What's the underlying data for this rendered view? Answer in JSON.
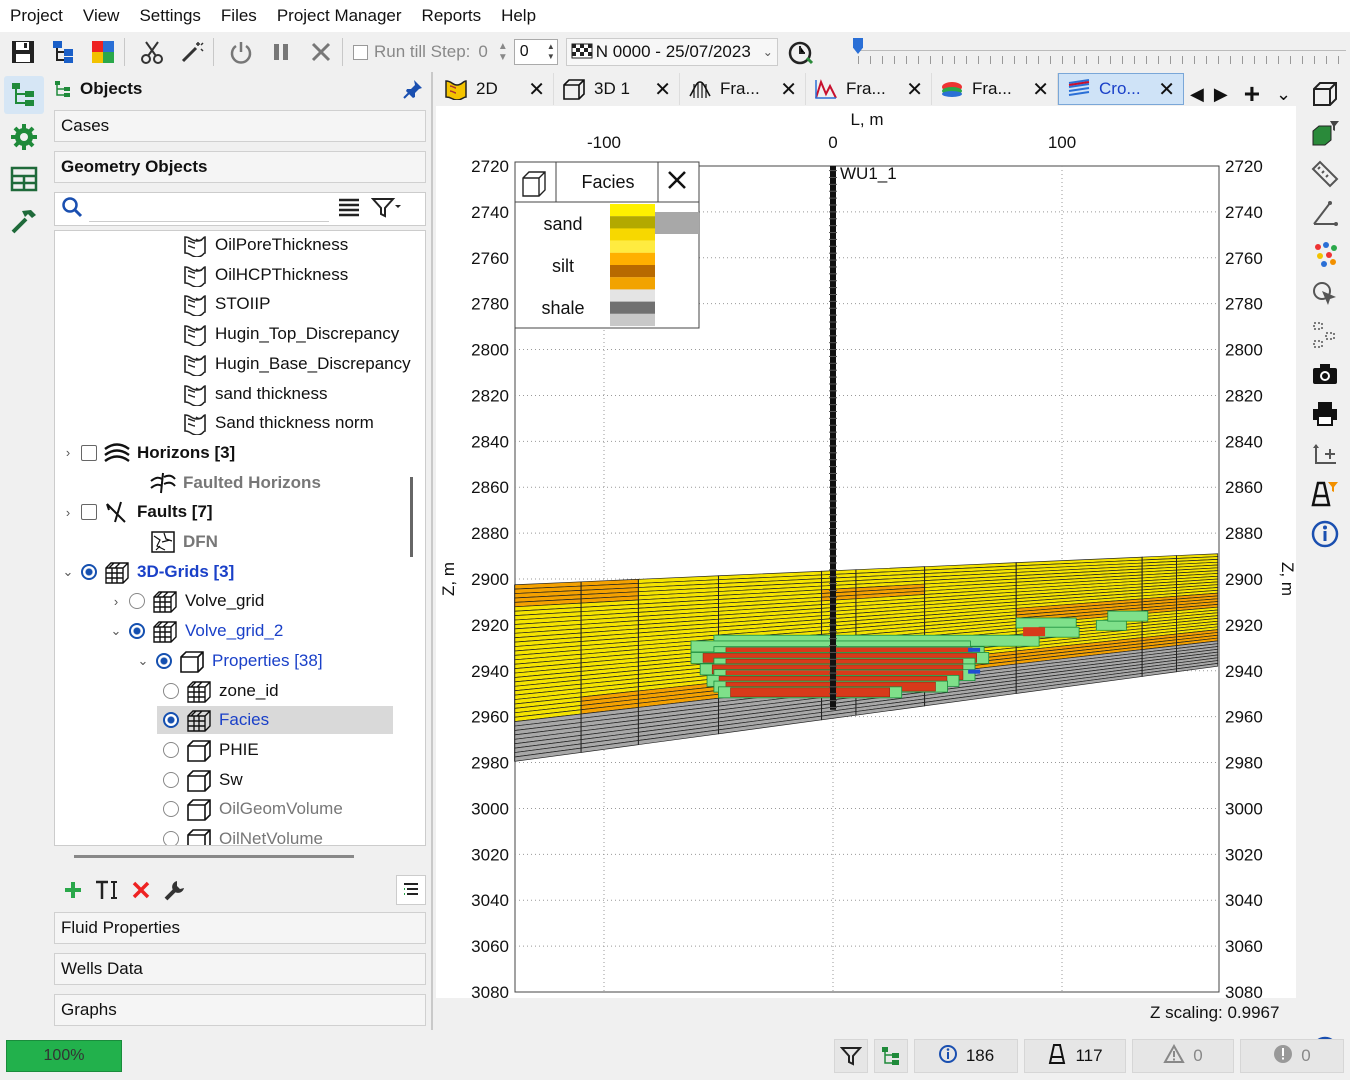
{
  "menu": [
    "Project",
    "View",
    "Settings",
    "Files",
    "Project Manager",
    "Reports",
    "Help"
  ],
  "toolbar": {
    "run_till_label": "Run till Step:",
    "run_till_value": "0",
    "step_value": "0",
    "date_label": "N 0000 - 25/07/2023"
  },
  "objects": {
    "title": "Objects",
    "sections_top": [
      "Cases",
      "Geometry Objects"
    ],
    "sections_bottom": [
      "Fluid Properties",
      "Wells Data",
      "Graphs"
    ],
    "search_placeholder": ""
  },
  "tree": [
    {
      "label": "OilPoreThickness",
      "indent": 3,
      "icon": "map-icon",
      "style": ""
    },
    {
      "label": "OilHCPThickness",
      "indent": 3,
      "icon": "map-icon",
      "style": ""
    },
    {
      "label": "STOIIP",
      "indent": 3,
      "icon": "map-icon",
      "style": ""
    },
    {
      "label": "Hugin_Top_Discrepancy",
      "indent": 3,
      "icon": "map-icon",
      "style": ""
    },
    {
      "label": "Hugin_Base_Discrepancy",
      "indent": 3,
      "icon": "map-icon",
      "style": ""
    },
    {
      "label": "sand thickness",
      "indent": 3,
      "icon": "map-icon",
      "style": ""
    },
    {
      "label": "Sand thickness norm",
      "indent": 3,
      "icon": "map-icon",
      "style": ""
    },
    {
      "label": "Horizons [3]",
      "indent": 0,
      "icon": "horizons-icon",
      "style": "bold",
      "exp": ">",
      "ctrl": "chk"
    },
    {
      "label": "Faulted Horizons",
      "indent": 1,
      "icon": "faulted-horizons-icon",
      "style": "bold gray"
    },
    {
      "label": "Faults [7]",
      "indent": 0,
      "icon": "faults-icon",
      "style": "bold",
      "exp": ">",
      "ctrl": "chk"
    },
    {
      "label": "DFN",
      "indent": 1,
      "icon": "dfn-icon",
      "style": "bold gray"
    },
    {
      "label": "3D-Grids [3]",
      "indent": 0,
      "icon": "grid-icon",
      "style": "bold blue",
      "exp": "v",
      "ctrl": "radon"
    },
    {
      "label": "Volve_grid",
      "indent": 1,
      "icon": "grid-icon",
      "style": "",
      "exp": ">",
      "ctrl": "rad"
    },
    {
      "label": "Volve_grid_2",
      "indent": 1,
      "icon": "grid-icon",
      "style": "blue",
      "exp": "v",
      "ctrl": "radon"
    },
    {
      "label": "Properties [38]",
      "indent": 2,
      "icon": "cube-icon",
      "style": "blue",
      "exp": "v",
      "ctrl": "radon"
    },
    {
      "label": "zone_id",
      "indent": 3,
      "icon": "grid-icon",
      "style": "",
      "ctrl": "rad"
    },
    {
      "label": "Facies",
      "indent": 3,
      "icon": "grid-icon",
      "style": "blue",
      "ctrl": "radon",
      "selected": true
    },
    {
      "label": "PHIE",
      "indent": 3,
      "icon": "cube-icon",
      "style": "",
      "ctrl": "rad"
    },
    {
      "label": "Sw",
      "indent": 3,
      "icon": "cube-icon",
      "style": "",
      "ctrl": "rad"
    },
    {
      "label": "OilGeomVolume",
      "indent": 3,
      "icon": "cube-icon",
      "style": "gray",
      "ctrl": "rad"
    },
    {
      "label": "OilNetVolume",
      "indent": 3,
      "icon": "cube-icon",
      "style": "gray",
      "ctrl": "rad"
    }
  ],
  "tabs": [
    {
      "label": "2D",
      "icon": "map-tab-icon",
      "active": false
    },
    {
      "label": "3D 1",
      "icon": "cube-tab-icon",
      "active": false
    },
    {
      "label": "Fra...",
      "icon": "frac-tab-icon",
      "active": false
    },
    {
      "label": "Fra...",
      "icon": "chart-tab-icon",
      "active": false
    },
    {
      "label": "Fra...",
      "icon": "surface-tab-icon",
      "active": false
    },
    {
      "label": "Cro...",
      "icon": "cross-tab-icon",
      "active": true
    }
  ],
  "plot": {
    "x_axis_title": "L, m",
    "x_ticks": [
      "-100",
      "0",
      "100"
    ],
    "y_axis_title": "Z, m",
    "y_ticks": [
      "2720",
      "2740",
      "2760",
      "2780",
      "2800",
      "2820",
      "2840",
      "2860",
      "2880",
      "2900",
      "2920",
      "2940",
      "2960",
      "2980",
      "3000",
      "3020",
      "3040",
      "3060",
      "3080"
    ],
    "well_name": "WU1_1",
    "legend_title": "Facies",
    "legend_items": [
      "sand",
      "silt",
      "shale"
    ],
    "z_scaling": "Z scaling: 0.9967",
    "colors": {
      "sand": "#f5e400",
      "silt": "#f4a100",
      "shale": "#a8a8a8",
      "oil": "#d83a1a",
      "gas": "#33c860"
    }
  },
  "status": {
    "progress": "100%",
    "info_count": "186",
    "flask_count": "117",
    "warning_count": "0",
    "error_count": "0"
  }
}
